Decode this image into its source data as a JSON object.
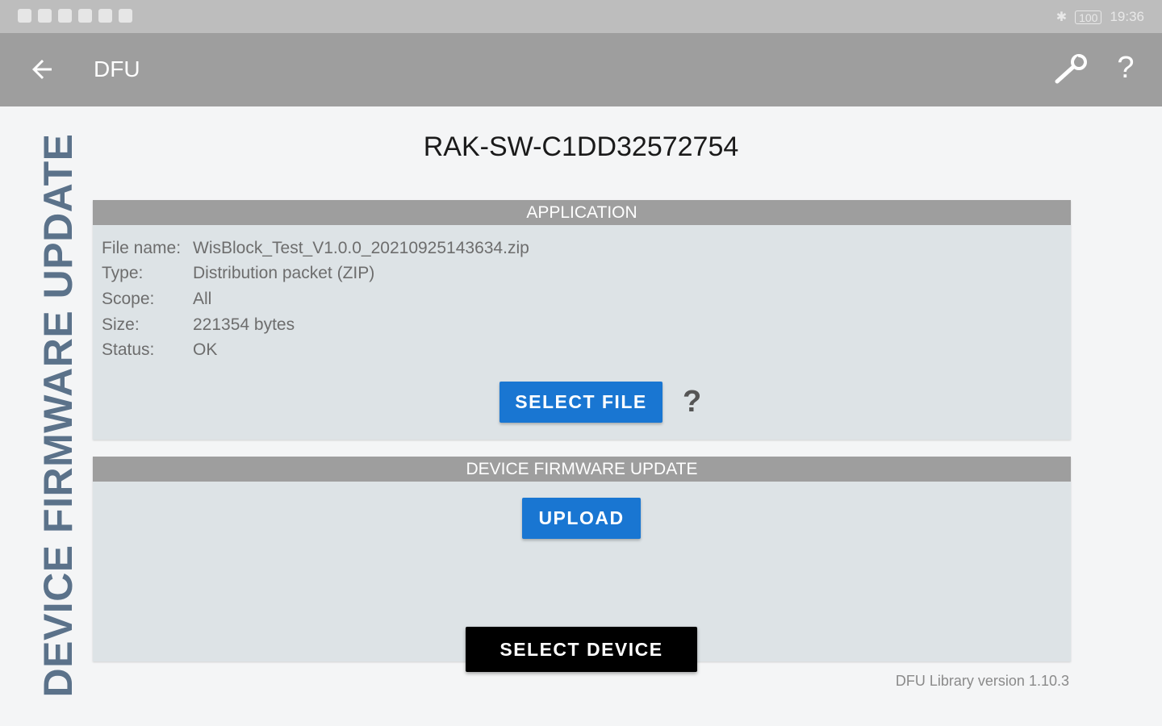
{
  "status_bar": {
    "time": "19:36",
    "battery": "100",
    "icons": [
      "notification-icon",
      "settings-icon",
      "usb-icon",
      "mail-icon",
      "crown-icon",
      "chat-icon",
      "bluetooth-icon",
      "battery-icon"
    ]
  },
  "toolbar": {
    "title": "DFU",
    "back_icon": "arrow-left-icon",
    "settings_icon": "wrench-icon",
    "help_label": "?"
  },
  "side_heading": "DEVICE FIRMWARE UPDATE",
  "device_name": "RAK-SW-C1DD32572754",
  "application": {
    "header": "APPLICATION",
    "rows": [
      {
        "key": "File name:",
        "value": "WisBlock_Test_V1.0.0_20210925143634.zip"
      },
      {
        "key": "Type:",
        "value": "Distribution packet (ZIP)"
      },
      {
        "key": "Scope:",
        "value": "All"
      },
      {
        "key": "Size:",
        "value": "221354 bytes"
      },
      {
        "key": "Status:",
        "value": "OK"
      }
    ],
    "select_file_label": "SELECT FILE",
    "help_label": "?"
  },
  "dfu": {
    "header": "DEVICE FIRMWARE UPDATE",
    "upload_label": "UPLOAD"
  },
  "select_device_label": "SELECT DEVICE",
  "library_version": "DFU Library version 1.10.3",
  "colors": {
    "toolbar": "#9e9e9e",
    "status_bar": "#bdbdbd",
    "panel": "#dde3e6",
    "accent_blue": "#1976d2",
    "heading": "#5b728a"
  }
}
